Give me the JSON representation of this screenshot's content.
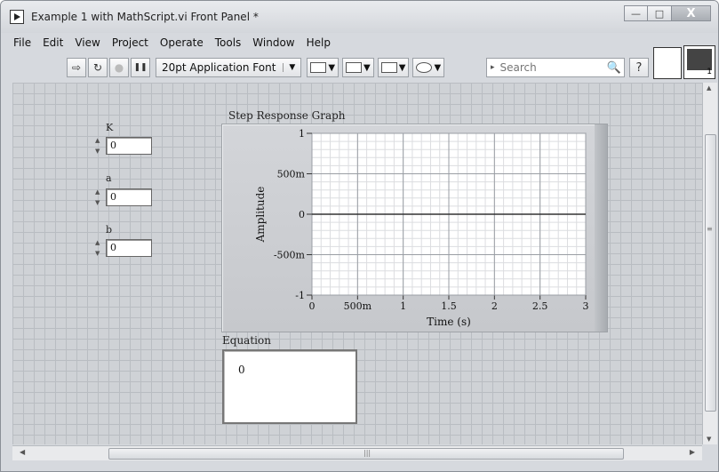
{
  "window": {
    "title": "Example 1 with MathScript.vi Front Panel *",
    "minimize": "—",
    "maximize": "□",
    "close": "X"
  },
  "menu": [
    "File",
    "Edit",
    "View",
    "Project",
    "Operate",
    "Tools",
    "Window",
    "Help"
  ],
  "toolbar": {
    "run": "⇨",
    "run_continuous": "↻",
    "abort": "●",
    "pause": "❚❚",
    "font": "20pt Application Font",
    "font_dropdown": "▼",
    "search_placeholder": "Search",
    "search_arrow": "▸",
    "search_icon": "🔍",
    "help": "?"
  },
  "vi_icon_number": "1",
  "controls": [
    {
      "label": "K",
      "value": "0"
    },
    {
      "label": "a",
      "value": "0"
    },
    {
      "label": "b",
      "value": "0"
    }
  ],
  "graph": {
    "label": "Step Response Graph"
  },
  "equation": {
    "label": "Equation",
    "value": "0"
  },
  "chart_data": {
    "type": "line",
    "title": "Step Response Graph",
    "xlabel": "Time (s)",
    "ylabel": "Amplitude",
    "xlim": [
      0,
      3
    ],
    "ylim": [
      -1,
      1
    ],
    "xticks": [
      "0",
      "500m",
      "1",
      "1.5",
      "2",
      "2.5",
      "3"
    ],
    "xtick_values": [
      0,
      0.5,
      1,
      1.5,
      2,
      2.5,
      3
    ],
    "yticks": [
      "1",
      "500m",
      "0",
      "-500m",
      "-1"
    ],
    "ytick_values": [
      1,
      0.5,
      0,
      -0.5,
      -1
    ],
    "grid": true,
    "series": [
      {
        "x": [
          0,
          3
        ],
        "y": [
          0,
          0
        ],
        "color": "#333333"
      }
    ]
  },
  "colors": {
    "plot_bg": "#ffffff",
    "major_grid": "#9a9ea4",
    "minor_grid": "#dcdde0"
  }
}
